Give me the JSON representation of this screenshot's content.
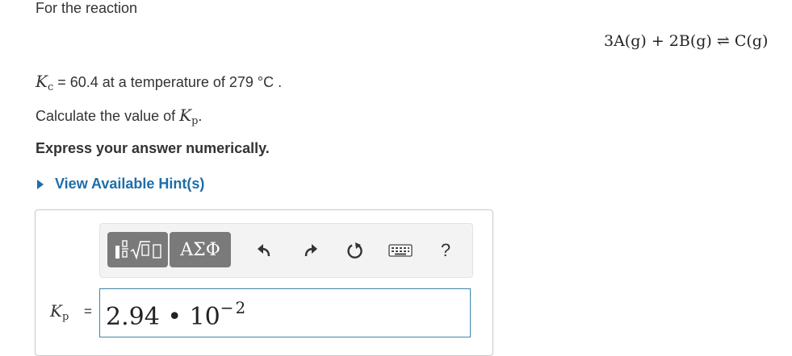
{
  "intro_text": "For the reaction",
  "equation": "3A(g) + 2B(g) ⇌ C(g)",
  "kc": {
    "symbol": "K",
    "subscript": "c",
    "text": " = 60.4 at a temperature of 279 °C ."
  },
  "calculate": {
    "text": "Calculate the value of ",
    "symbol": "K",
    "subscript": "p",
    "suffix": "."
  },
  "express_text": "Express your answer numerically.",
  "hint_link": "View Available Hint(s)",
  "toolbar": {
    "template_icon": "fraction-sqrt-template-icon",
    "greek_label": "ΑΣΦ",
    "undo_icon": "undo-icon",
    "redo_icon": "redo-icon",
    "reset_icon": "reset-icon",
    "keyboard_icon": "keyboard-icon",
    "help_label": "?"
  },
  "answer": {
    "label_symbol": "K",
    "label_subscript": "p",
    "equals": "=",
    "mantissa": "2.94 • 10",
    "exponent": "−2"
  },
  "colors": {
    "link": "#1e6ea8",
    "input_border": "#3d85a8",
    "toolbar_button": "#7a7a7a"
  }
}
